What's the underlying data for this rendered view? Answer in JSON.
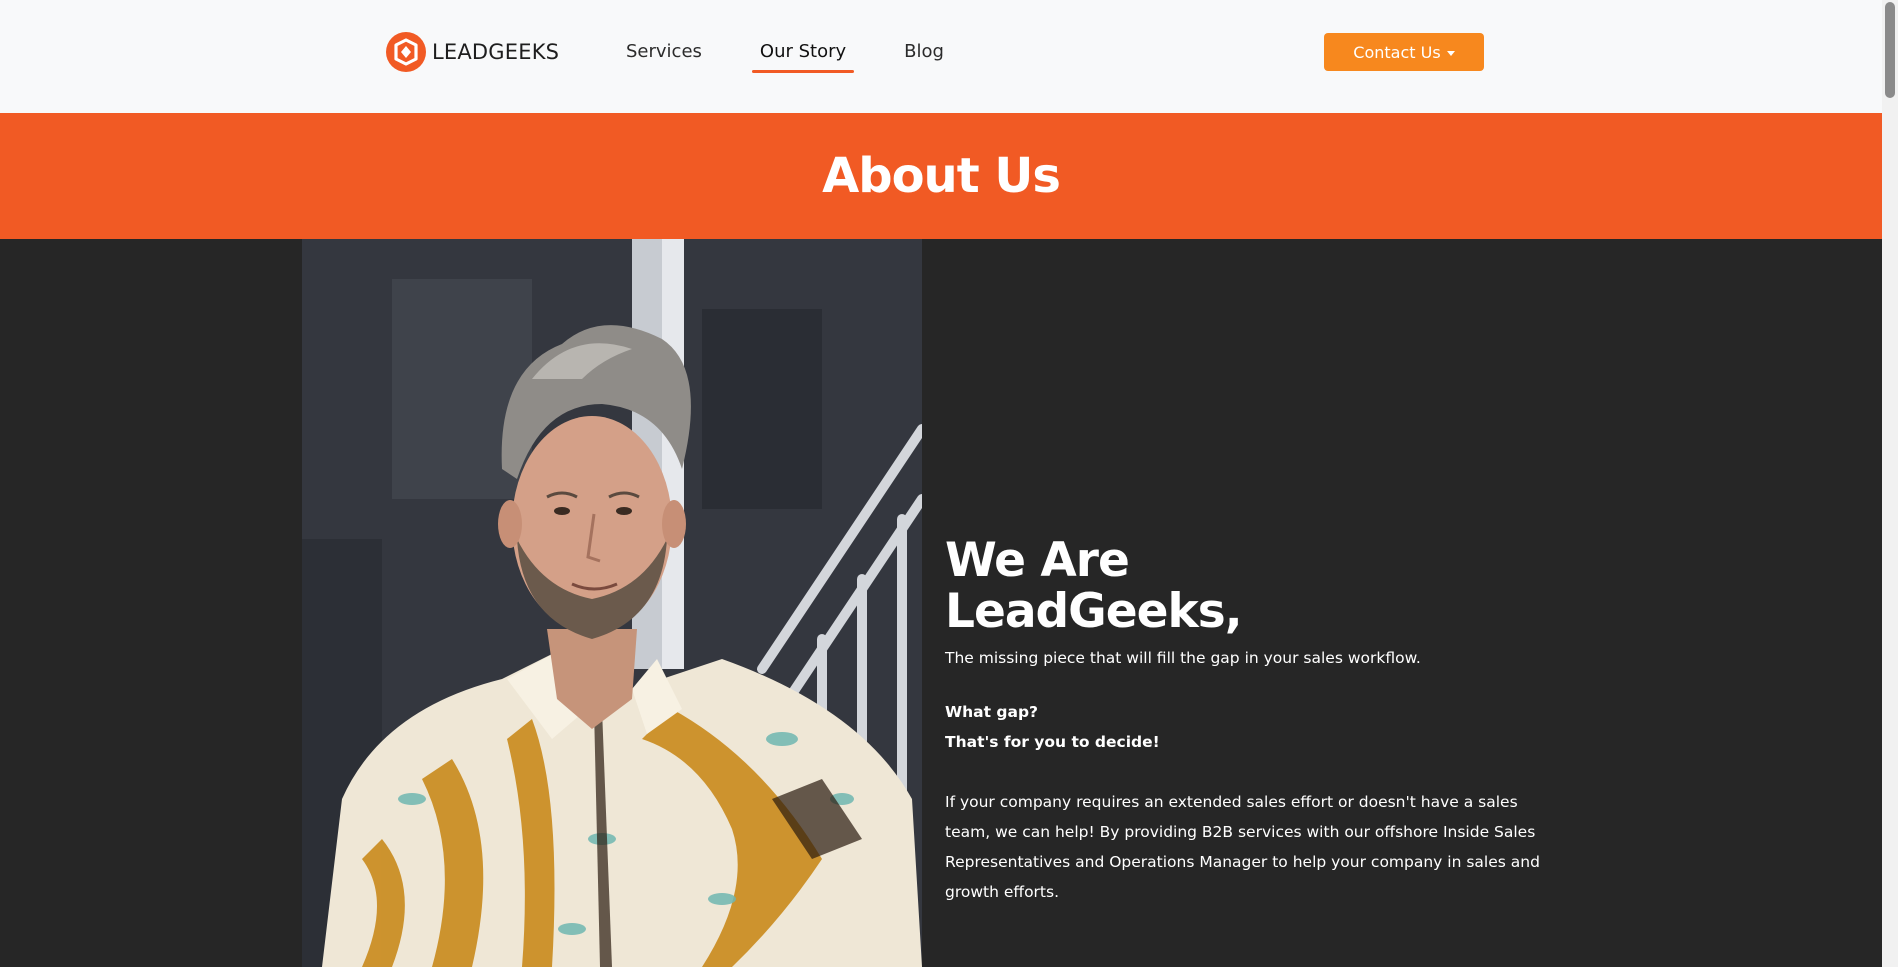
{
  "brand": {
    "name": "LEADGEEKS",
    "accent_color": "#f15a24",
    "button_color": "#f7881e",
    "dark_bg": "#262626"
  },
  "nav": {
    "items": [
      {
        "label": "Services",
        "active": false
      },
      {
        "label": "Our Story",
        "active": true
      },
      {
        "label": "Blog",
        "active": false
      }
    ],
    "contact_label": "Contact Us"
  },
  "hero": {
    "title": "About Us"
  },
  "about": {
    "title": "We Are LeadGeeks,",
    "tagline": "The missing piece that will fill the gap in your sales workflow.",
    "question": "What gap?",
    "answer": "That's for you to decide!",
    "body": "If your company requires an extended sales effort or doesn't have a sales team, we can help! By providing B2B services with our offshore Inside Sales Representatives and Operations Manager to help your company in sales and growth efforts."
  }
}
